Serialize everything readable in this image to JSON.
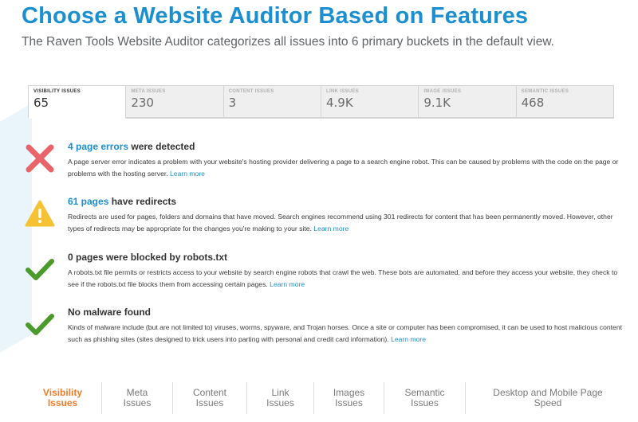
{
  "header": {
    "title": "Choose a Website Auditor Based on Features",
    "subtitle": "The Raven Tools Website Auditor categorizes all issues into 6 primary buckets in the default view."
  },
  "tabs": [
    {
      "label": "VISIBILITY ISSUES",
      "value": "65",
      "active": true
    },
    {
      "label": "META ISSUES",
      "value": "230"
    },
    {
      "label": "CONTENT ISSUES",
      "value": "3"
    },
    {
      "label": "LINK ISSUES",
      "value": "4.9K"
    },
    {
      "label": "IMAGE ISSUES",
      "value": "9.1K"
    },
    {
      "label": "SEMANTIC ISSUES",
      "value": "468"
    }
  ],
  "issues": [
    {
      "icon": "error-x-icon",
      "title_highlight": "4 page errors",
      "title_rest": " were detected",
      "description": "A page server error indicates a problem with your website's hosting provider delivering a page to a search engine robot. This can be caused by problems with the code on the page or problems with the hosting server.",
      "link": "Learn more"
    },
    {
      "icon": "warning-triangle-icon",
      "title_highlight": "61 pages",
      "title_rest": " have redirects",
      "description": "Redirects are used for pages, folders and domains that have moved. Search engines recommend using 301 redirects for content that has been permanently moved. However, other types of redirects may be appropriate for the changes you're making to your site.",
      "link": "Learn more"
    },
    {
      "icon": "checkmark-icon",
      "title_highlight": "",
      "title_rest": "0 pages were blocked by robots.txt",
      "description": "A robots.txt file permits or restricts access to your website by search engine robots that crawl the web. These bots are automated, and before they access your website, they check to see if the robots.txt file blocks them from accessing certain pages.",
      "link": "Learn more"
    },
    {
      "icon": "checkmark-icon",
      "title_highlight": "",
      "title_rest": "No malware found",
      "description": "Kinds of malware include (but are not limited to) viruses, worms, spyware, and Trojan horses. Once a site or computer has been compromised, it can be used to host malicious content such as phishing sites (sites designed to trick users into parting with personal and credit card information).",
      "link": "Learn more"
    }
  ],
  "bottom_nav": [
    {
      "line1": "Visibility",
      "line2": "Issues",
      "active": true
    },
    {
      "line1": "Meta",
      "line2": "Issues"
    },
    {
      "line1": "Content",
      "line2": "Issues"
    },
    {
      "line1": "Link",
      "line2": "Issues"
    },
    {
      "line1": "Images",
      "line2": "Issues"
    },
    {
      "line1": "Semantic",
      "line2": "Issues"
    },
    {
      "line1": "Desktop and Mobile Page",
      "line2": "Speed"
    }
  ],
  "colors": {
    "accent_blue": "#1b8fd0",
    "active_orange": "#f07c2a",
    "error_red": "#e8636a",
    "warning_yellow": "#f6c234",
    "success_green": "#4a9a2c"
  }
}
